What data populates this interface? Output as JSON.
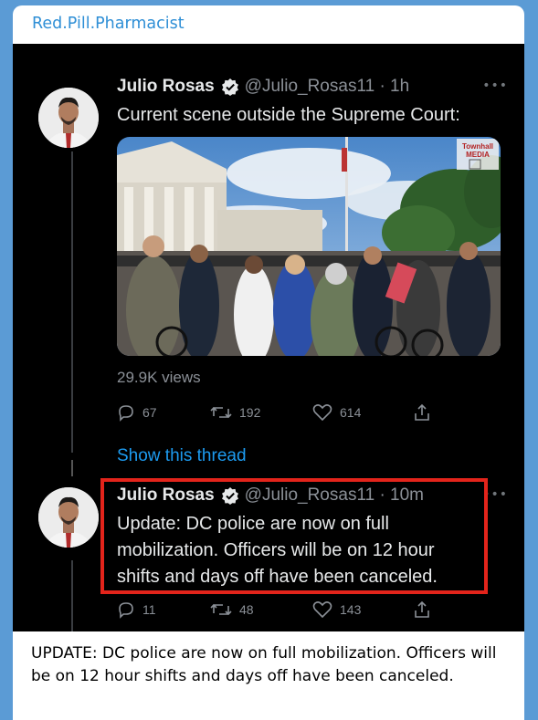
{
  "channel": {
    "title": "Red.Pill.Pharmacist"
  },
  "tweet1": {
    "name": "Julio Rosas",
    "handle": "@Julio_Rosas11 · 1h",
    "text": "Current scene outside the Supreme Court:",
    "media_watermark": "Townhall MEDIA",
    "views": "29.9K views",
    "replies": "67",
    "retweets": "192",
    "likes": "614",
    "show_thread": "Show this thread"
  },
  "tweet2": {
    "name": "Julio Rosas",
    "handle": "@Julio_Rosas11 · 10m",
    "text_lines": [
      "Update: DC police are now on full",
      "mobilization. Officers will be on 12 hour",
      "shifts and days off have been canceled."
    ],
    "replies": "11",
    "retweets": "48",
    "likes": "143"
  },
  "caption": "UPDATE: DC police are now on full mobilization. Officers will be on 12 hour shifts and days off have been canceled.",
  "colors": {
    "channel_link": "#2f8fd6",
    "tweet_link": "#1d9bf0",
    "highlight_border": "#e3241b",
    "verified_badge": "#e7e9ea"
  }
}
